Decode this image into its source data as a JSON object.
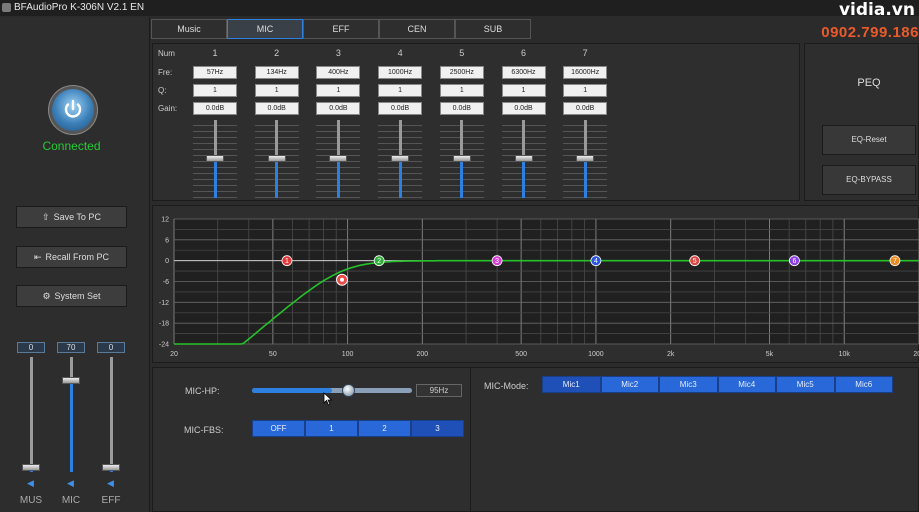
{
  "titlebar": {
    "title": "BFAudioPro K-306N V2.1 EN"
  },
  "watermark": {
    "brand": "vidia.vn",
    "phone": "0902.799.186"
  },
  "left": {
    "status": "Connected",
    "buttons": [
      {
        "label": "Save To PC",
        "icon": "upload-icon"
      },
      {
        "label": "Recall From PC",
        "icon": "recall-icon"
      },
      {
        "label": "System Set",
        "icon": "gear-icon"
      }
    ],
    "channels": [
      {
        "label": "MUS",
        "value": "0",
        "level": 0
      },
      {
        "label": "MIC",
        "value": "70",
        "level": 0.81
      },
      {
        "label": "EFF",
        "value": "0",
        "level": 0
      }
    ]
  },
  "tabs": [
    {
      "label": "Music"
    },
    {
      "label": "MIC"
    },
    {
      "label": "EFF"
    },
    {
      "label": "CEN"
    },
    {
      "label": "SUB"
    }
  ],
  "active_tab": "MIC",
  "peq": {
    "row_labels": {
      "num": "Num",
      "freq": "Fre:",
      "q": "Q:",
      "gain": "Gain:"
    },
    "bands": [
      {
        "num": "1",
        "freq": "57Hz",
        "q": "1",
        "gain": "0.0dB"
      },
      {
        "num": "2",
        "freq": "134Hz",
        "q": "1",
        "gain": "0.0dB"
      },
      {
        "num": "3",
        "freq": "400Hz",
        "q": "1",
        "gain": "0.0dB"
      },
      {
        "num": "4",
        "freq": "1000Hz",
        "q": "1",
        "gain": "0.0dB"
      },
      {
        "num": "5",
        "freq": "2500Hz",
        "q": "1",
        "gain": "0.0dB"
      },
      {
        "num": "6",
        "freq": "6300Hz",
        "q": "1",
        "gain": "0.0dB"
      },
      {
        "num": "7",
        "freq": "16000Hz",
        "q": "1",
        "gain": "0.0dB"
      }
    ],
    "side_title": "PEQ",
    "reset_label": "EQ-Reset",
    "bypass_label": "EQ-BYPASS"
  },
  "graph": {
    "y_ticks": [
      "12",
      "6",
      "0",
      "-6",
      "-12",
      "-18",
      "-24"
    ],
    "x_ticks": [
      {
        "label": "20",
        "f": 20
      },
      {
        "label": "50",
        "f": 50
      },
      {
        "label": "100",
        "f": 100
      },
      {
        "label": "200",
        "f": 200
      },
      {
        "label": "500",
        "f": 500
      },
      {
        "label": "1000",
        "f": 1000
      },
      {
        "label": "2k",
        "f": 2000
      },
      {
        "label": "5k",
        "f": 5000
      },
      {
        "label": "10k",
        "f": 10000
      },
      {
        "label": "20k",
        "f": 20000
      }
    ],
    "markers": [
      {
        "label": "1",
        "f": 57,
        "db": 0,
        "color": "#e23a3a"
      },
      {
        "label": "2",
        "f": 134,
        "db": 0,
        "color": "#2fae3a"
      },
      {
        "label": "3",
        "f": 400,
        "db": 0,
        "color": "#d63fd6"
      },
      {
        "label": "4",
        "f": 1000,
        "db": 0,
        "color": "#2c56e0"
      },
      {
        "label": "5",
        "f": 2500,
        "db": 0,
        "color": "#d94646"
      },
      {
        "label": "6",
        "f": 6300,
        "db": 0,
        "color": "#8b3fe0"
      },
      {
        "label": "7",
        "f": 16000,
        "db": 0,
        "color": "#ec8a22"
      }
    ],
    "hp_marker": {
      "f": 95,
      "db": -5.5,
      "color": "#e84a4a"
    },
    "curve_color": "#27c229"
  },
  "mic": {
    "hp_label": "MIC-HP:",
    "hp_value": "95Hz",
    "hp_level": 0.5,
    "fbs_label": "MIC-FBS:",
    "fbs_options": [
      "OFF",
      "1",
      "2",
      "3"
    ],
    "fbs_selected": "3",
    "mode_label": "MIC-Mode:",
    "mode_options": [
      "Mic1",
      "Mic2",
      "Mic3",
      "Mic4",
      "Mic5",
      "Mic6"
    ],
    "mode_selected": "Mic1"
  }
}
